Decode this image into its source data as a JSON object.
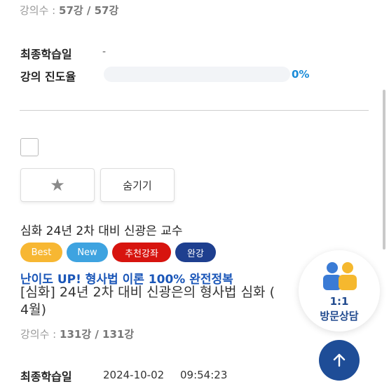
{
  "top": {
    "lecture_count_label": "강의수 :",
    "lecture_count_value": "57강 / 57강",
    "last_study_label": "최종학습일",
    "last_study_value": "-",
    "progress_label": "강의 진도율",
    "progress_value": 0,
    "progress_text": "0%"
  },
  "actions": {
    "star_icon": "star-icon",
    "hide_label": "숨기기"
  },
  "course": {
    "subtitle": "심화 24년 2차 대비 신광은 교수",
    "badges": [
      {
        "label": "Best",
        "color": "#f7b733"
      },
      {
        "label": "New",
        "color": "#3ea3e0"
      },
      {
        "label": "추천강좌",
        "color": "#d7140f"
      },
      {
        "label": "완강",
        "color": "#1e3f8f"
      }
    ],
    "headline": "난이도 UP! 형사법 이론 100% 완전정복",
    "name_line1": "[심화] 24년 2차 대비 신광은의 형사법 심화 (",
    "name_line2": "4월)",
    "lecture_count_label": "강의수 :",
    "lecture_count_value": "131강 / 131강",
    "last_study_label": "최종학습일",
    "last_study_date": "2024-10-02",
    "last_study_time": "09:54:23"
  },
  "floating": {
    "consult_line1": "1:1",
    "consult_line2": "방문상담",
    "people_icon": "people-icon",
    "top_icon": "arrow-up-icon"
  },
  "colors": {
    "primary": "#1e4d97",
    "progress_text": "#1a8cd8",
    "headline": "#1a56b8"
  }
}
